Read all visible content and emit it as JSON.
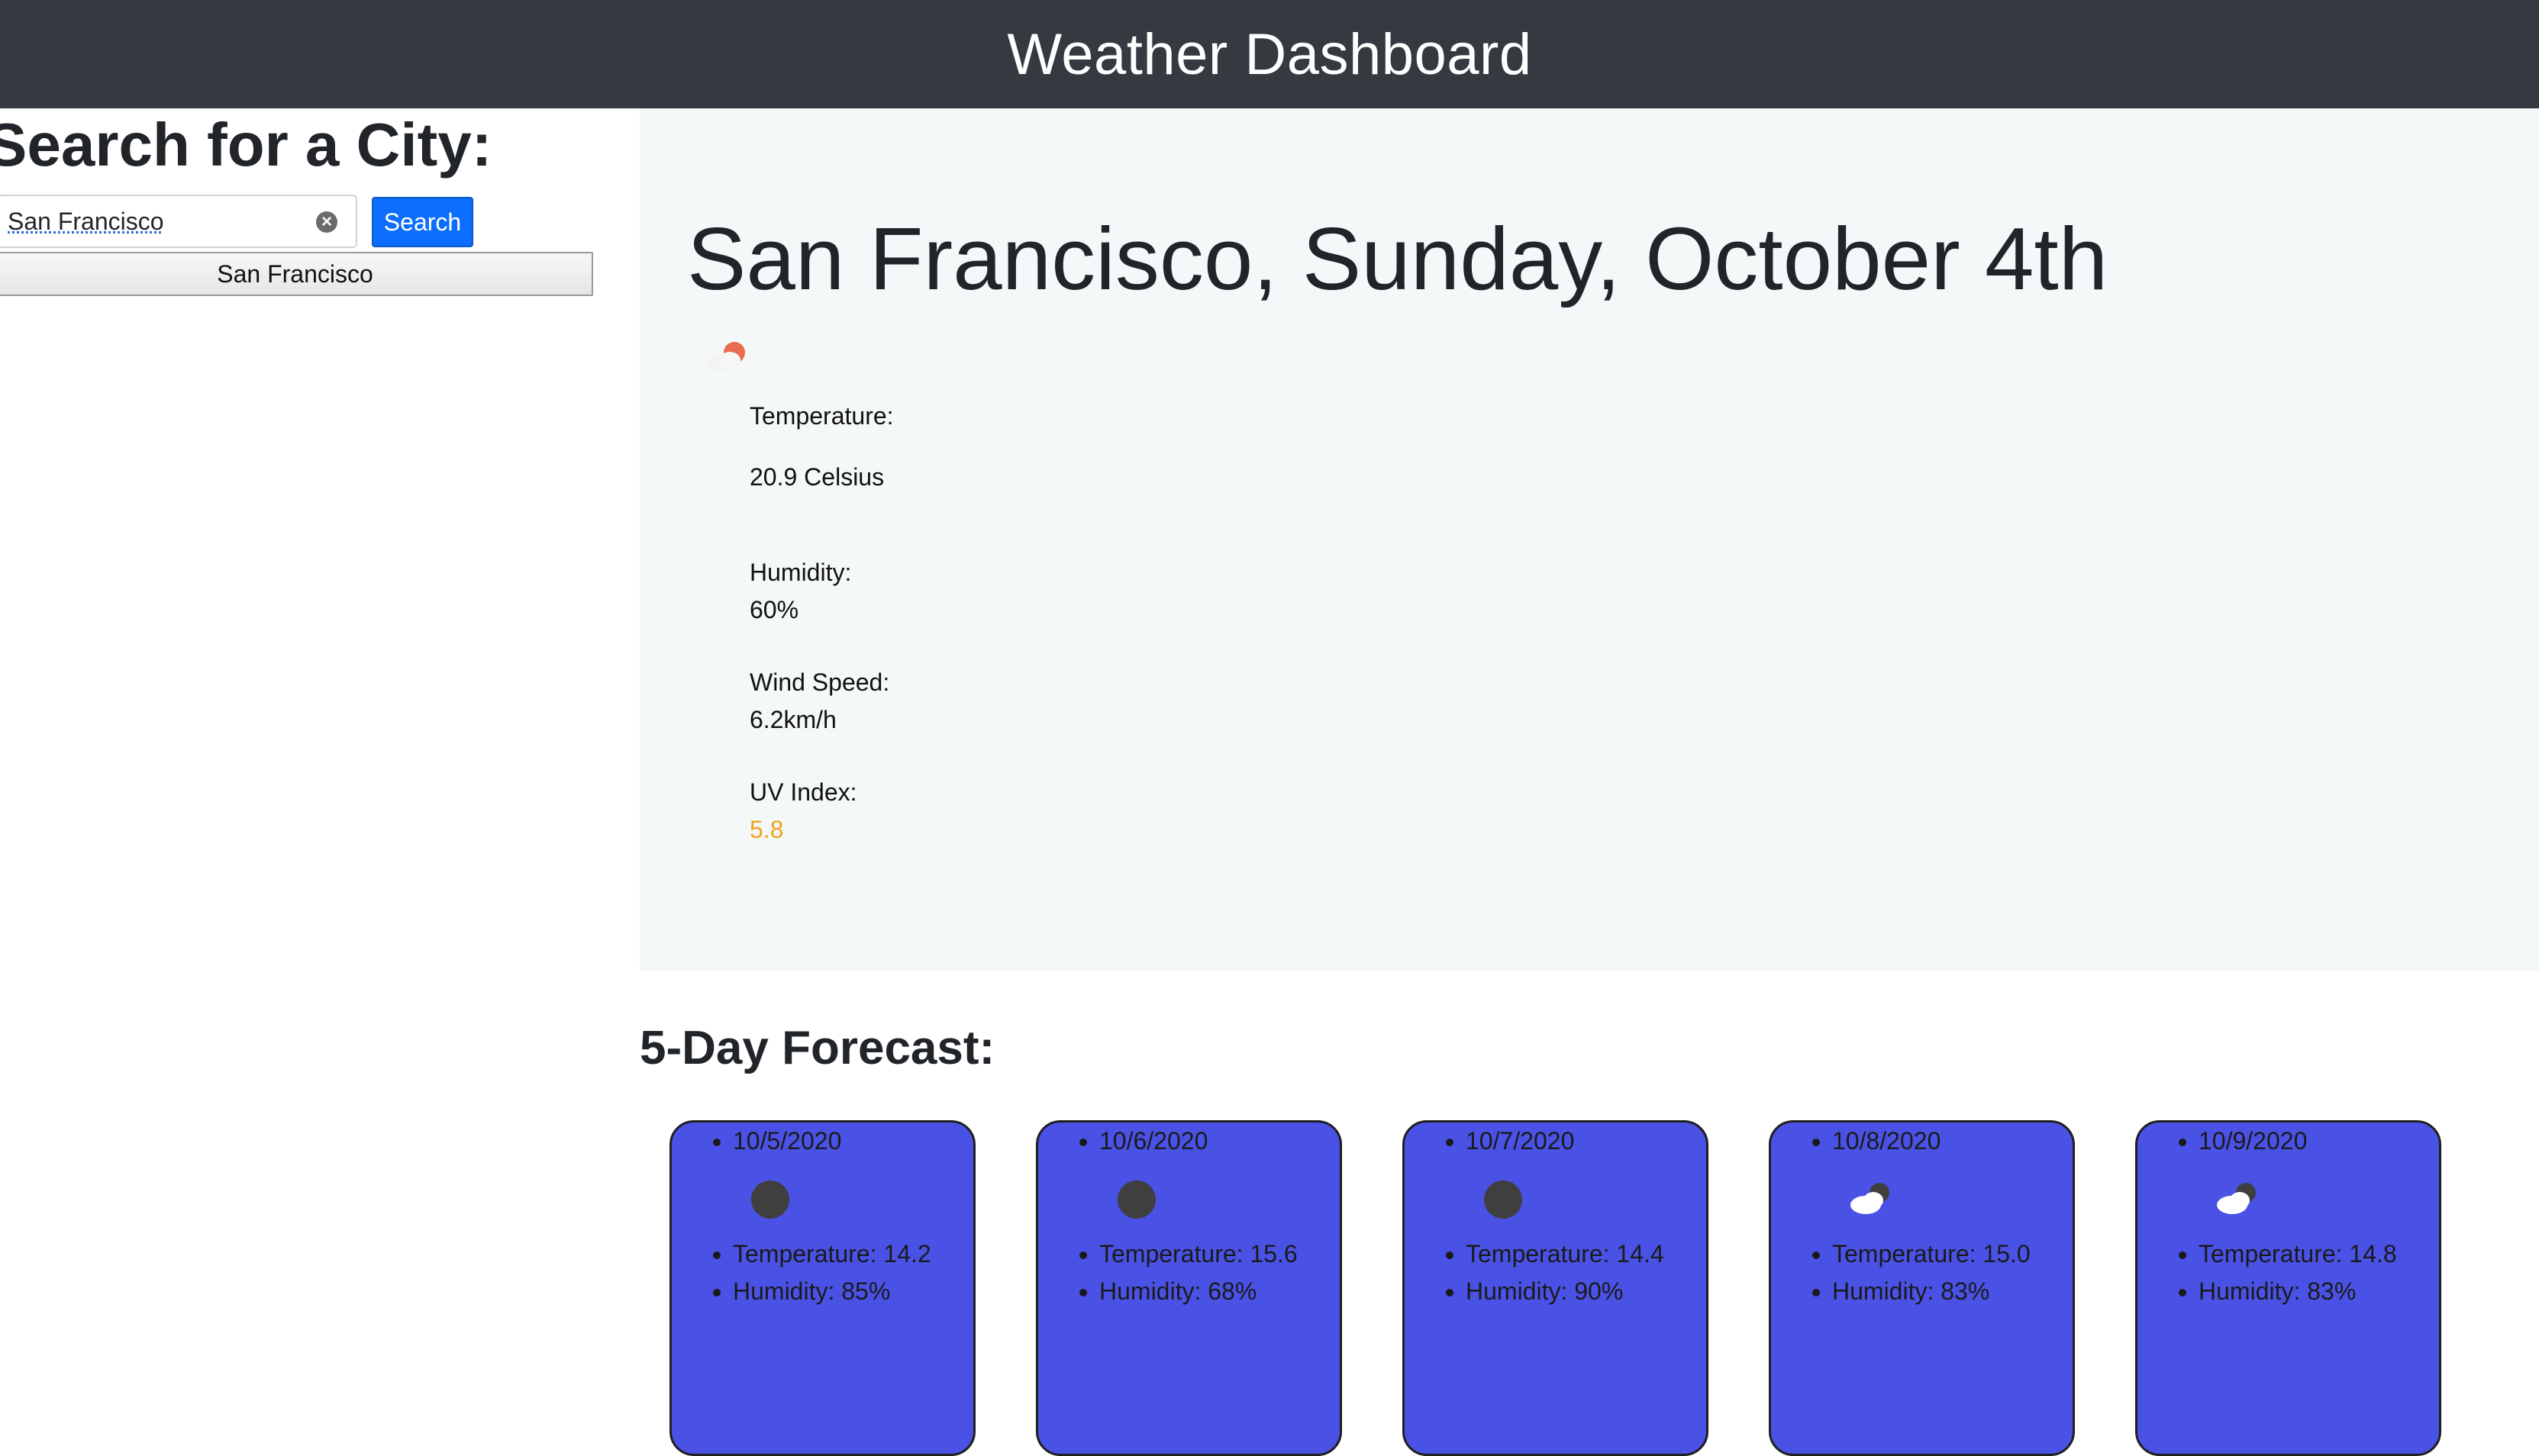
{
  "header": {
    "title": "Weather Dashboard"
  },
  "search": {
    "title": "Search for a City:",
    "input_value": "San Francisco",
    "clear_icon": "clear-icon",
    "button_label": "Search",
    "history": [
      "San Francisco"
    ]
  },
  "current": {
    "title": "San Francisco, Sunday, October 4th",
    "icon": "partly-sunny-icon",
    "temperature_label": "Temperature:",
    "temperature_value": "20.9 Celsius",
    "humidity_label": "Humidity:",
    "humidity_value": "60%",
    "wind_label": "Wind Speed:",
    "wind_value": "6.2km/h",
    "uv_label": "UV Index:",
    "uv_value": "5.8",
    "uv_color": "#f0a21c"
  },
  "forecast": {
    "title": "5-Day Forecast:",
    "card_color": "#4a52e6",
    "days": [
      {
        "date": "10/5/2020",
        "icon": "night-clear-icon",
        "temperature": "Temperature: 14.2",
        "humidity": "Humidity: 85%"
      },
      {
        "date": "10/6/2020",
        "icon": "night-clear-icon",
        "temperature": "Temperature: 15.6",
        "humidity": "Humidity: 68%"
      },
      {
        "date": "10/7/2020",
        "icon": "night-clear-icon",
        "temperature": "Temperature: 14.4",
        "humidity": "Humidity: 90%"
      },
      {
        "date": "10/8/2020",
        "icon": "cloudy-night-icon",
        "temperature": "Temperature: 15.0",
        "humidity": "Humidity: 83%"
      },
      {
        "date": "10/9/2020",
        "icon": "cloudy-night-icon",
        "temperature": "Temperature: 14.8",
        "humidity": "Humidity: 83%"
      }
    ]
  }
}
